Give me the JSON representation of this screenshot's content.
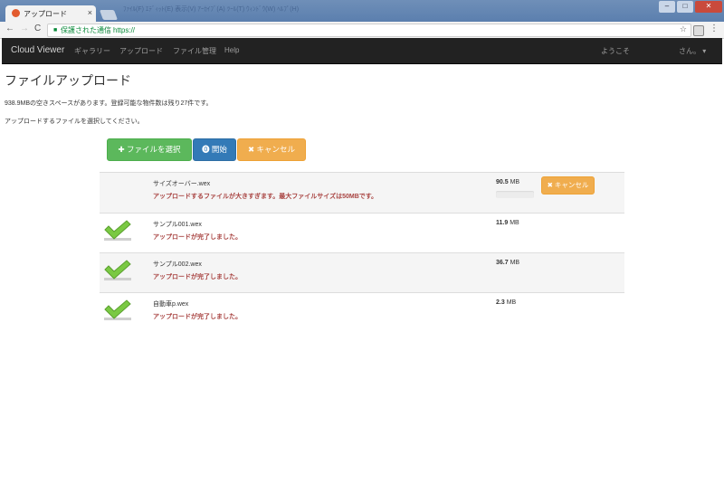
{
  "browser": {
    "tab_title": "アップロード",
    "tab_close": "×",
    "back": "←",
    "forward": "→",
    "reload": "C",
    "secure_label": "保護された通信",
    "url": "https://",
    "star": "☆",
    "menu": "⋮",
    "ghost_menu": "ﾌｧｲﾙ(F)  ｴﾃﾞｨｯﾄ(E)  表示(V)  ｱｰｶｲﾌﾞ(A)  ﾂｰﾙ(T)  ｳｨﾝﾄﾞｳ(W)  ﾍﾙﾌﾟ(H)",
    "window_buttons": {
      "minimize": "–",
      "maximize": "□",
      "close": "✕"
    }
  },
  "navbar": {
    "brand": "Cloud Viewer",
    "links": [
      "ギャラリー",
      "アップロード",
      "ファイル管理",
      "Help"
    ],
    "welcome": "ようこそ",
    "user": "さん。 ▾"
  },
  "page": {
    "title": "ファイルアップロード",
    "free_space": "938.9MBの空きスペースがあります。登録可能な物件数は残り27件です。",
    "instruction": "アップロードするファイルを選択してください。"
  },
  "toolbar": {
    "select_label": "✚ ファイルを選択",
    "start_label": "⓿ 開始",
    "cancel_label": "✖ キャンセル"
  },
  "uploads": [
    {
      "filename": "サイズオーバー.wex",
      "message": "アップロードするファイルが大きすぎます。最大ファイルサイズは50MBです。",
      "size": "90.5",
      "unit": "MB",
      "status": "error",
      "progress": 0,
      "cancel_label": "✖ キャンセル"
    },
    {
      "filename": "サンプル001.wex",
      "message": "アップロードが完了しました。",
      "size": "11.9",
      "unit": "MB",
      "status": "done"
    },
    {
      "filename": "サンプル002.wex",
      "message": "アップロードが完了しました。",
      "size": "36.7",
      "unit": "MB",
      "status": "done"
    },
    {
      "filename": "自動車p.wex",
      "message": "アップロードが完了しました。",
      "size": "2.3",
      "unit": "MB",
      "status": "done"
    }
  ],
  "colors": {
    "success": "#5cb85c",
    "primary": "#337ab7",
    "warning": "#f0ad4e",
    "error_text": "#a94442",
    "check": "#7ac943"
  },
  "icons": {
    "check": "check-icon",
    "plus": "plus-icon",
    "start": "upload-circle-icon",
    "cancel": "x-icon"
  }
}
